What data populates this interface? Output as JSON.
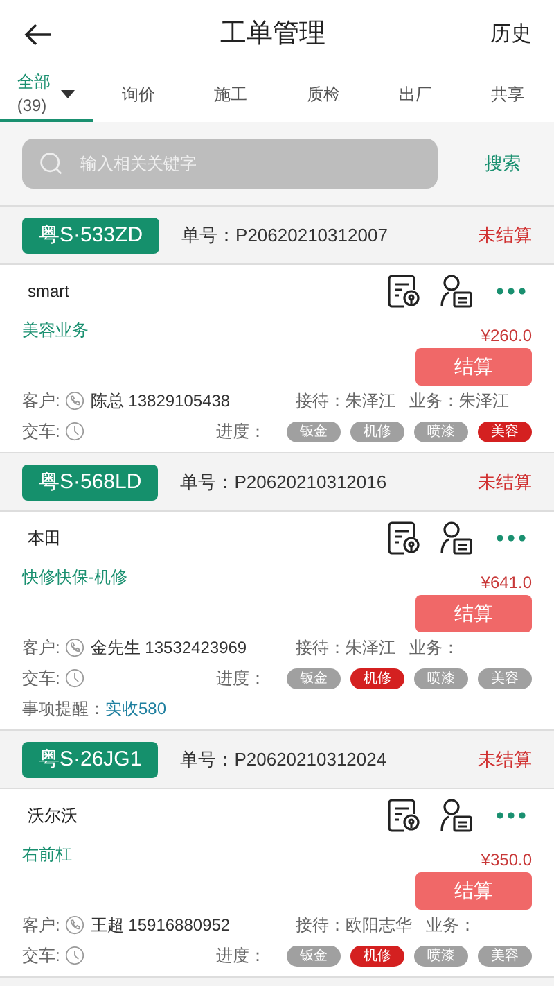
{
  "header": {
    "title": "工单管理",
    "history": "历史"
  },
  "tabs": [
    {
      "label": "全部",
      "count": "(39)",
      "selected": true,
      "dropdown": true
    },
    {
      "label": "询价",
      "selected": false
    },
    {
      "label": "施工",
      "selected": false
    },
    {
      "label": "质检",
      "selected": false
    },
    {
      "label": "出厂",
      "selected": false
    },
    {
      "label": "共享",
      "selected": false
    }
  ],
  "search": {
    "placeholder": "输入相关关键字",
    "button": "搜索"
  },
  "orders": [
    {
      "plate": "粤S·533ZD",
      "order_no": "单号：P20620210312007",
      "status": "未结算",
      "car": "smart",
      "service": "美容业务",
      "amount": "¥260.0",
      "settle": "结算",
      "customer_label": "客户:",
      "customer": "陈总 13829105438",
      "reception": "接待：朱泽江",
      "business": "业务：朱泽江",
      "delivery_label": "交车:",
      "progress_label": "进度：",
      "progress": [
        {
          "label": "钣金",
          "active": false
        },
        {
          "label": "机修",
          "active": false
        },
        {
          "label": "喷漆",
          "active": false
        },
        {
          "label": "美容",
          "active": true
        }
      ]
    },
    {
      "plate": "粤S·568LD",
      "order_no": "单号：P20620210312016",
      "status": "未结算",
      "car": "本田",
      "service": "快修快保-机修",
      "amount": "¥641.0",
      "settle": "结算",
      "customer_label": "客户:",
      "customer": "金先生 13532423969",
      "reception": "接待：朱泽江",
      "business": "业务：",
      "delivery_label": "交车:",
      "progress_label": "进度：",
      "progress": [
        {
          "label": "钣金",
          "active": false
        },
        {
          "label": "机修",
          "active": true
        },
        {
          "label": "喷漆",
          "active": false
        },
        {
          "label": "美容",
          "active": false
        }
      ],
      "reminder_label": "事项提醒：",
      "reminder": "实收580"
    },
    {
      "plate": "粤S·26JG1",
      "order_no": "单号：P20620210312024",
      "status": "未结算",
      "car": "沃尔沃",
      "service": "右前杠",
      "amount": "¥350.0",
      "settle": "结算",
      "customer_label": "客户:",
      "customer": "王超 15916880952",
      "reception": "接待：欧阳志华",
      "business": "业务：",
      "delivery_label": "交车:",
      "progress_label": "进度：",
      "progress": [
        {
          "label": "钣金",
          "active": false
        },
        {
          "label": "机修",
          "active": true
        },
        {
          "label": "喷漆",
          "active": false
        },
        {
          "label": "美容",
          "active": false
        }
      ]
    }
  ]
}
